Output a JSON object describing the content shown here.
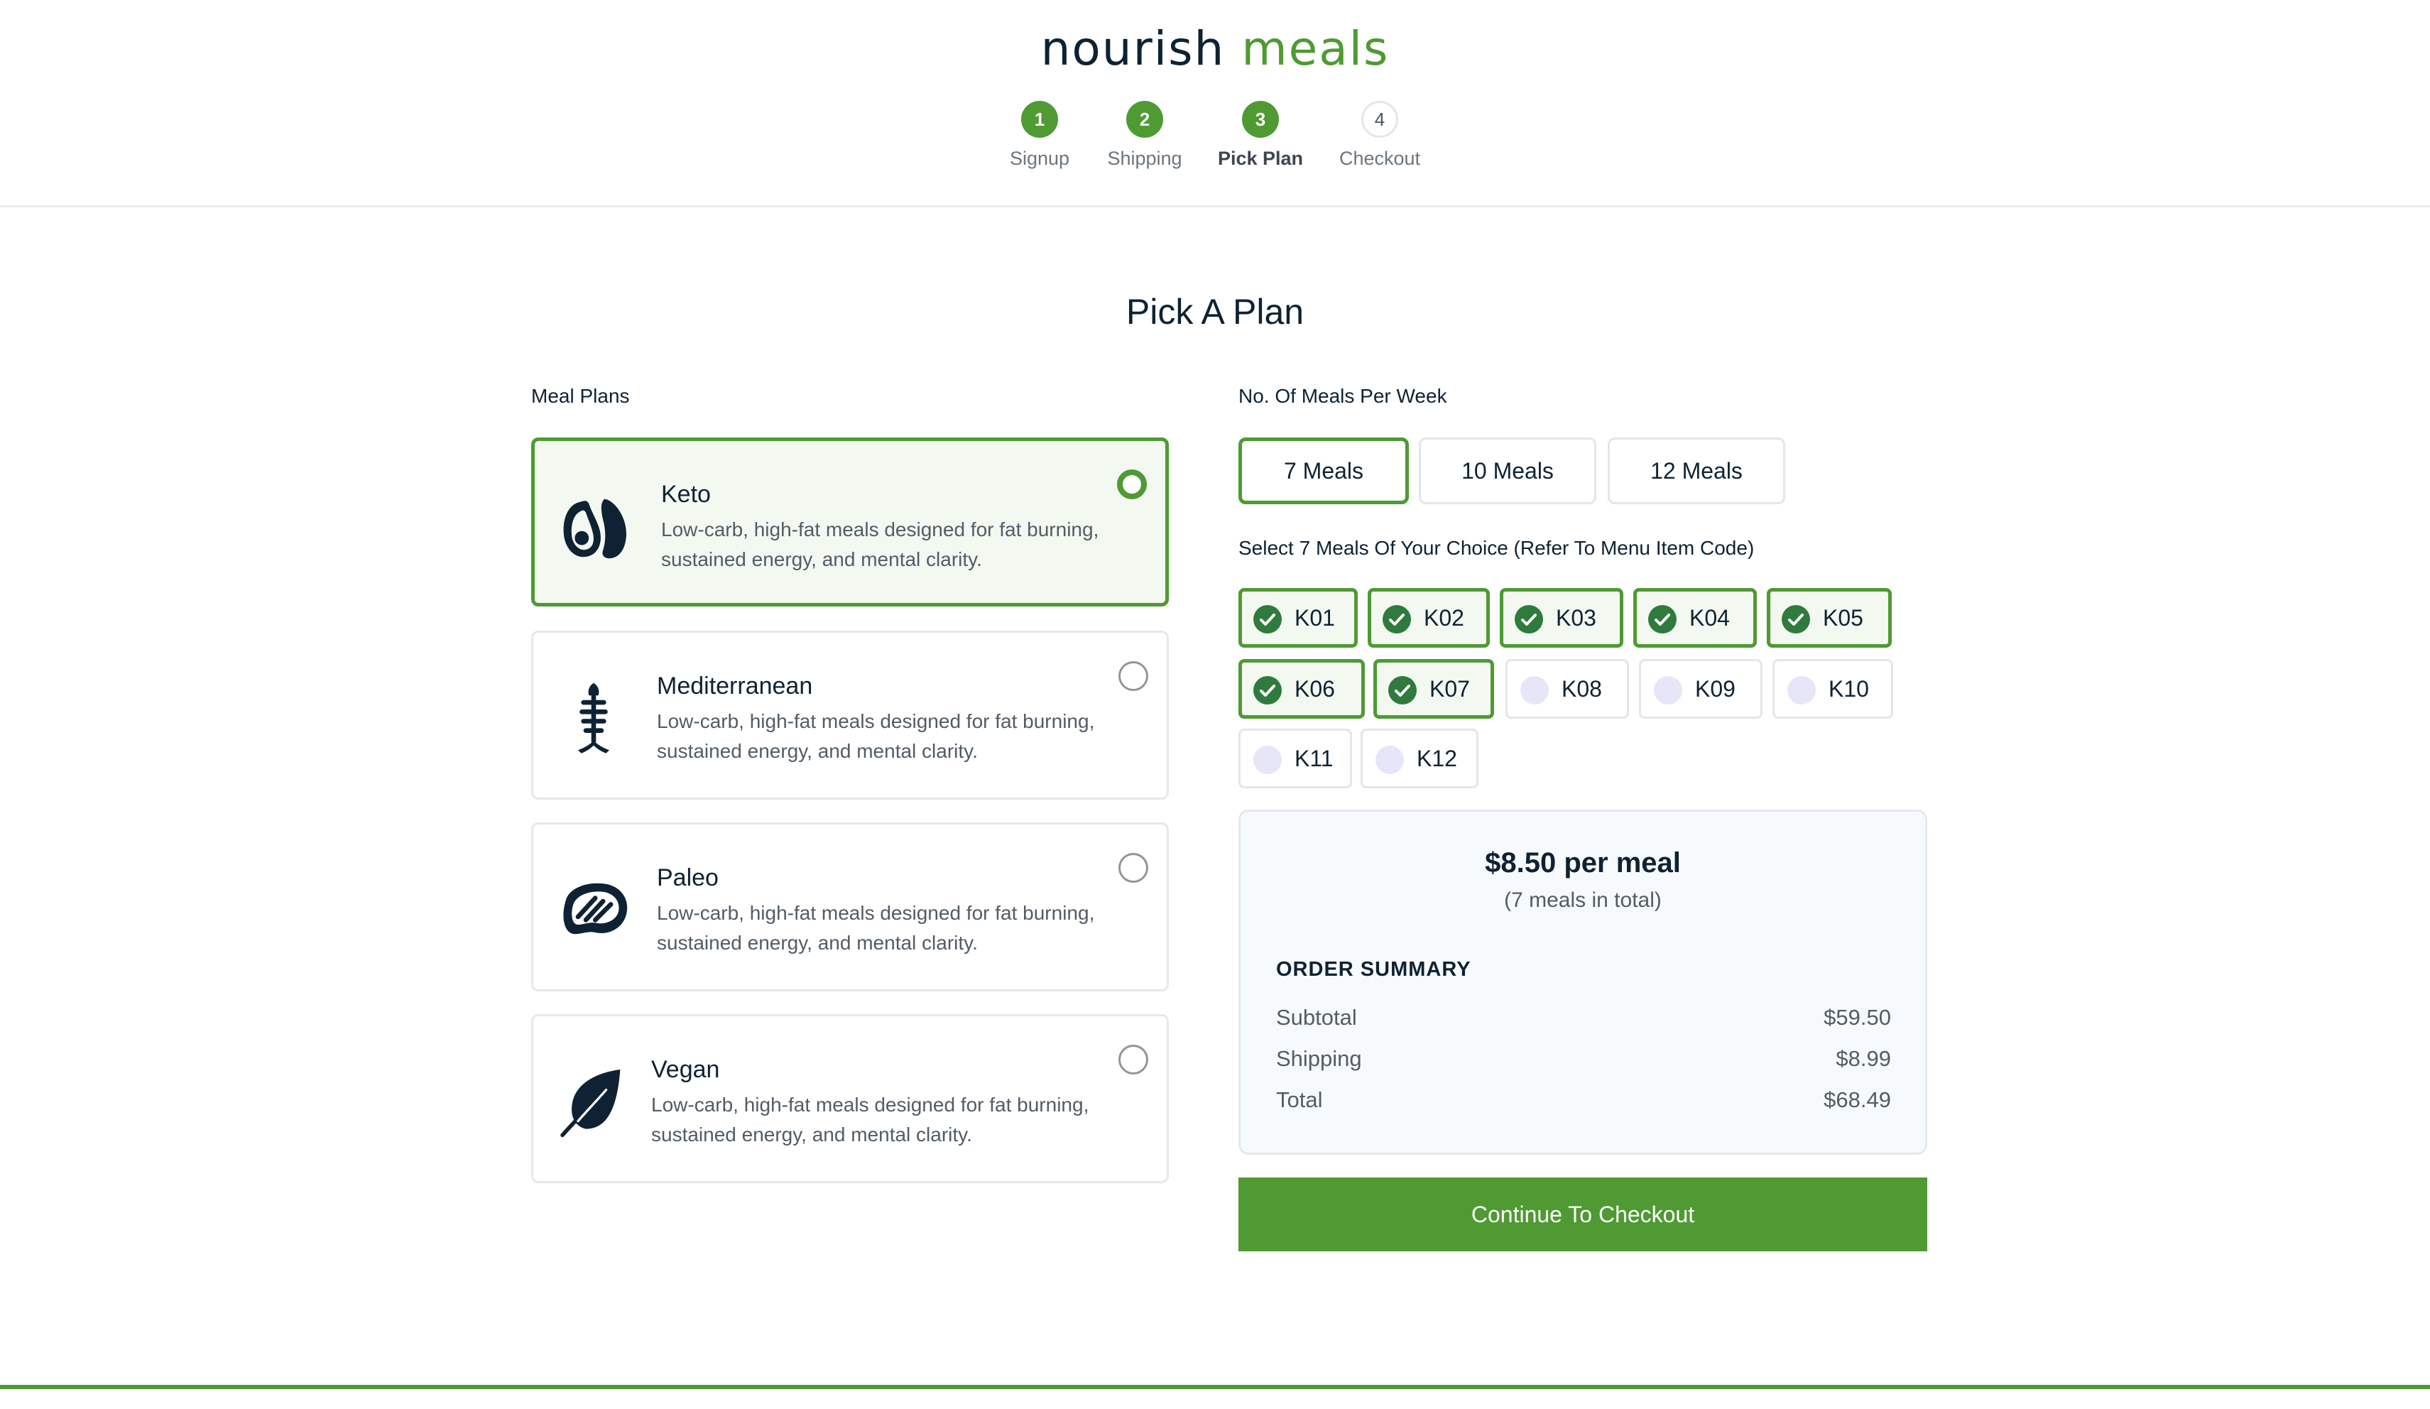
{
  "brand": {
    "word1": "nourish",
    "word2": "meals"
  },
  "steps": [
    {
      "number": "1",
      "label": "Signup",
      "state": "done"
    },
    {
      "number": "2",
      "label": "Shipping",
      "state": "done"
    },
    {
      "number": "3",
      "label": "Pick Plan",
      "state": "active"
    },
    {
      "number": "4",
      "label": "Checkout",
      "state": "todo"
    }
  ],
  "page_title": "Pick A Plan",
  "meal_plans": {
    "label": "Meal Plans",
    "selected": "Keto",
    "plans": [
      {
        "name": "Keto",
        "description": "Low-carb, high-fat meals designed for fat burning, sustained energy, and mental clarity.",
        "icon": "avocado-icon",
        "selected": true
      },
      {
        "name": "Mediterranean",
        "description": "Low-carb, high-fat meals designed for fat burning, sustained energy, and mental clarity.",
        "icon": "fish-bone-icon",
        "selected": false
      },
      {
        "name": "Paleo",
        "description": "Low-carb, high-fat meals designed for fat burning, sustained energy, and mental clarity.",
        "icon": "steak-icon",
        "selected": false
      },
      {
        "name": "Vegan",
        "description": "Low-carb, high-fat meals designed for fat burning, sustained energy, and mental clarity.",
        "icon": "leaf-icon",
        "selected": false
      }
    ]
  },
  "meals_per_week": {
    "label": "No. Of Meals Per Week",
    "options": [
      {
        "label": "7 Meals",
        "selected": true
      },
      {
        "label": "10 Meals",
        "selected": false
      },
      {
        "label": "12 Meals",
        "selected": false
      }
    ]
  },
  "meal_selection": {
    "label": "Select 7 Meals Of Your Choice (Refer To Menu Item Code)",
    "items": [
      {
        "code": "K01",
        "selected": true
      },
      {
        "code": "K02",
        "selected": true
      },
      {
        "code": "K03",
        "selected": true
      },
      {
        "code": "K04",
        "selected": true
      },
      {
        "code": "K05",
        "selected": true
      },
      {
        "code": "K06",
        "selected": true
      },
      {
        "code": "K07",
        "selected": true
      },
      {
        "code": "K08",
        "selected": false
      },
      {
        "code": "K09",
        "selected": false
      },
      {
        "code": "K10",
        "selected": false
      },
      {
        "code": "K11",
        "selected": false
      },
      {
        "code": "K12",
        "selected": false
      }
    ]
  },
  "summary": {
    "price": "$8.50 per meal",
    "price_note": "(7 meals in total)",
    "title": "ORDER SUMMARY",
    "rows": [
      {
        "label": "Subtotal",
        "value": "$59.50"
      },
      {
        "label": "Shipping",
        "value": "$8.99"
      },
      {
        "label": "Total",
        "value": "$68.49"
      }
    ]
  },
  "cta_label": "Continue To Checkout",
  "colors": {
    "brand_green": "#4f9a33",
    "dark_text": "#0e2233",
    "check_green": "#2f7a3d",
    "unchecked_circle": "#e6e6f8"
  }
}
